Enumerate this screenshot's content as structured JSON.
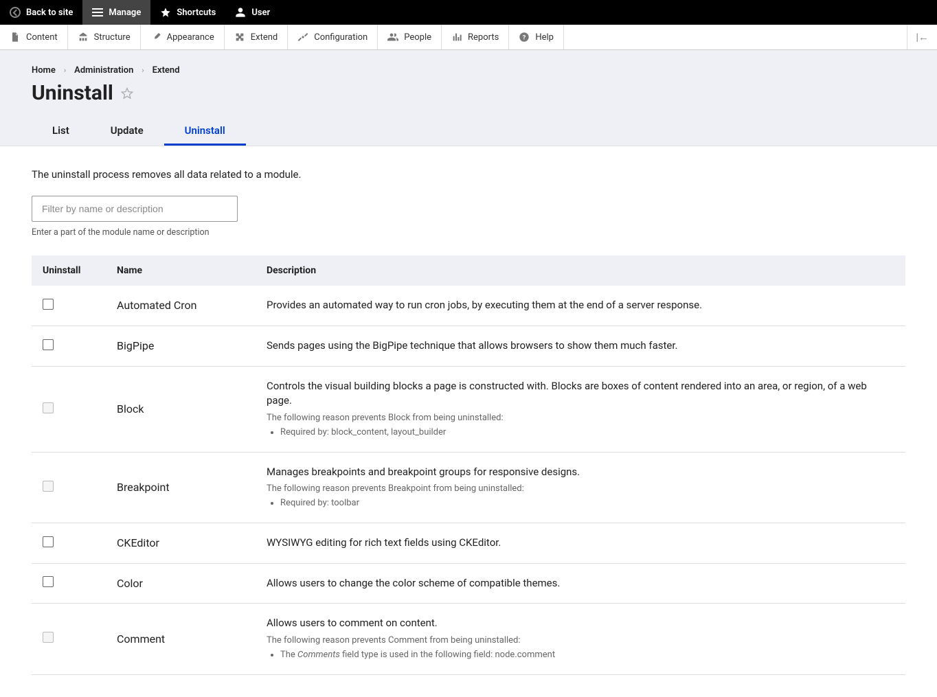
{
  "toolbar": {
    "back": "Back to site",
    "manage": "Manage",
    "shortcuts": "Shortcuts",
    "user": "User"
  },
  "adminMenu": {
    "content": "Content",
    "structure": "Structure",
    "appearance": "Appearance",
    "extend": "Extend",
    "configuration": "Configuration",
    "people": "People",
    "reports": "Reports",
    "help": "Help"
  },
  "breadcrumb": {
    "home": "Home",
    "admin": "Administration",
    "extend": "Extend"
  },
  "page": {
    "title": "Uninstall",
    "intro": "The uninstall process removes all data related to a module.",
    "filterPlaceholder": "Filter by name or description",
    "filterHelp": "Enter a part of the module name or description"
  },
  "tabs": {
    "list": "List",
    "update": "Update",
    "uninstall": "Uninstall"
  },
  "table": {
    "headers": {
      "uninstall": "Uninstall",
      "name": "Name",
      "description": "Description"
    },
    "rows": [
      {
        "name": "Automated Cron",
        "desc": "Provides an automated way to run cron jobs, by executing them at the end of a server response.",
        "disabled": false
      },
      {
        "name": "BigPipe",
        "desc": "Sends pages using the BigPipe technique that allows browsers to show them much faster.",
        "disabled": false
      },
      {
        "name": "Block",
        "desc": "Controls the visual building blocks a page is constructed with. Blocks are boxes of content rendered into an area, or region, of a web page.",
        "disabled": true,
        "preventLabel": "The following reason prevents Block from being uninstalled:",
        "preventReasons": [
          "Required by: block_content, layout_builder"
        ]
      },
      {
        "name": "Breakpoint",
        "desc": "Manages breakpoints and breakpoint groups for responsive designs.",
        "disabled": true,
        "preventLabel": "The following reason prevents Breakpoint from being uninstalled:",
        "preventReasons": [
          "Required by: toolbar"
        ]
      },
      {
        "name": "CKEditor",
        "desc": "WYSIWYG editing for rich text fields using CKEditor.",
        "disabled": false
      },
      {
        "name": "Color",
        "desc": "Allows users to change the color scheme of compatible themes.",
        "disabled": false
      },
      {
        "name": "Comment",
        "desc": "Allows users to comment on content.",
        "disabled": true,
        "preventLabel": "The following reason prevents Comment from being uninstalled:",
        "preventReasonsHtml": [
          "The <em>Comments</em> field type is used in the following field: node.comment"
        ]
      }
    ]
  }
}
